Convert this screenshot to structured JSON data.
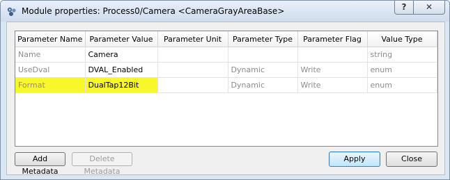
{
  "window": {
    "title": "Module properties: Process0/Camera <CameraGrayAreaBase>",
    "help_label": "?",
    "close_label": "✕"
  },
  "table": {
    "columns": [
      "Parameter Name",
      "Parameter Value",
      "Parameter Unit",
      "Parameter Type",
      "Parameter Flag",
      "Value Type"
    ],
    "rows": [
      {
        "name": "Name",
        "value": "Camera",
        "unit": "",
        "type": "",
        "flag": "",
        "value_type": "string"
      },
      {
        "name": "UseDval",
        "value": "DVAL_Enabled",
        "unit": "",
        "type": "Dynamic",
        "flag": "Write",
        "value_type": "enum"
      },
      {
        "name": "Format",
        "value": "DualTap12Bit",
        "unit": "",
        "type": "Dynamic",
        "flag": "Write",
        "value_type": "enum"
      }
    ]
  },
  "buttons": {
    "add_metadata": "Add Metadata",
    "delete_metadata": "Delete Metadata",
    "apply": "Apply",
    "close": "Close"
  },
  "colors": {
    "highlight": "#f7f72a",
    "window_frame": "#dbe6f3"
  },
  "icons": {
    "app": "module-properties-icon"
  }
}
